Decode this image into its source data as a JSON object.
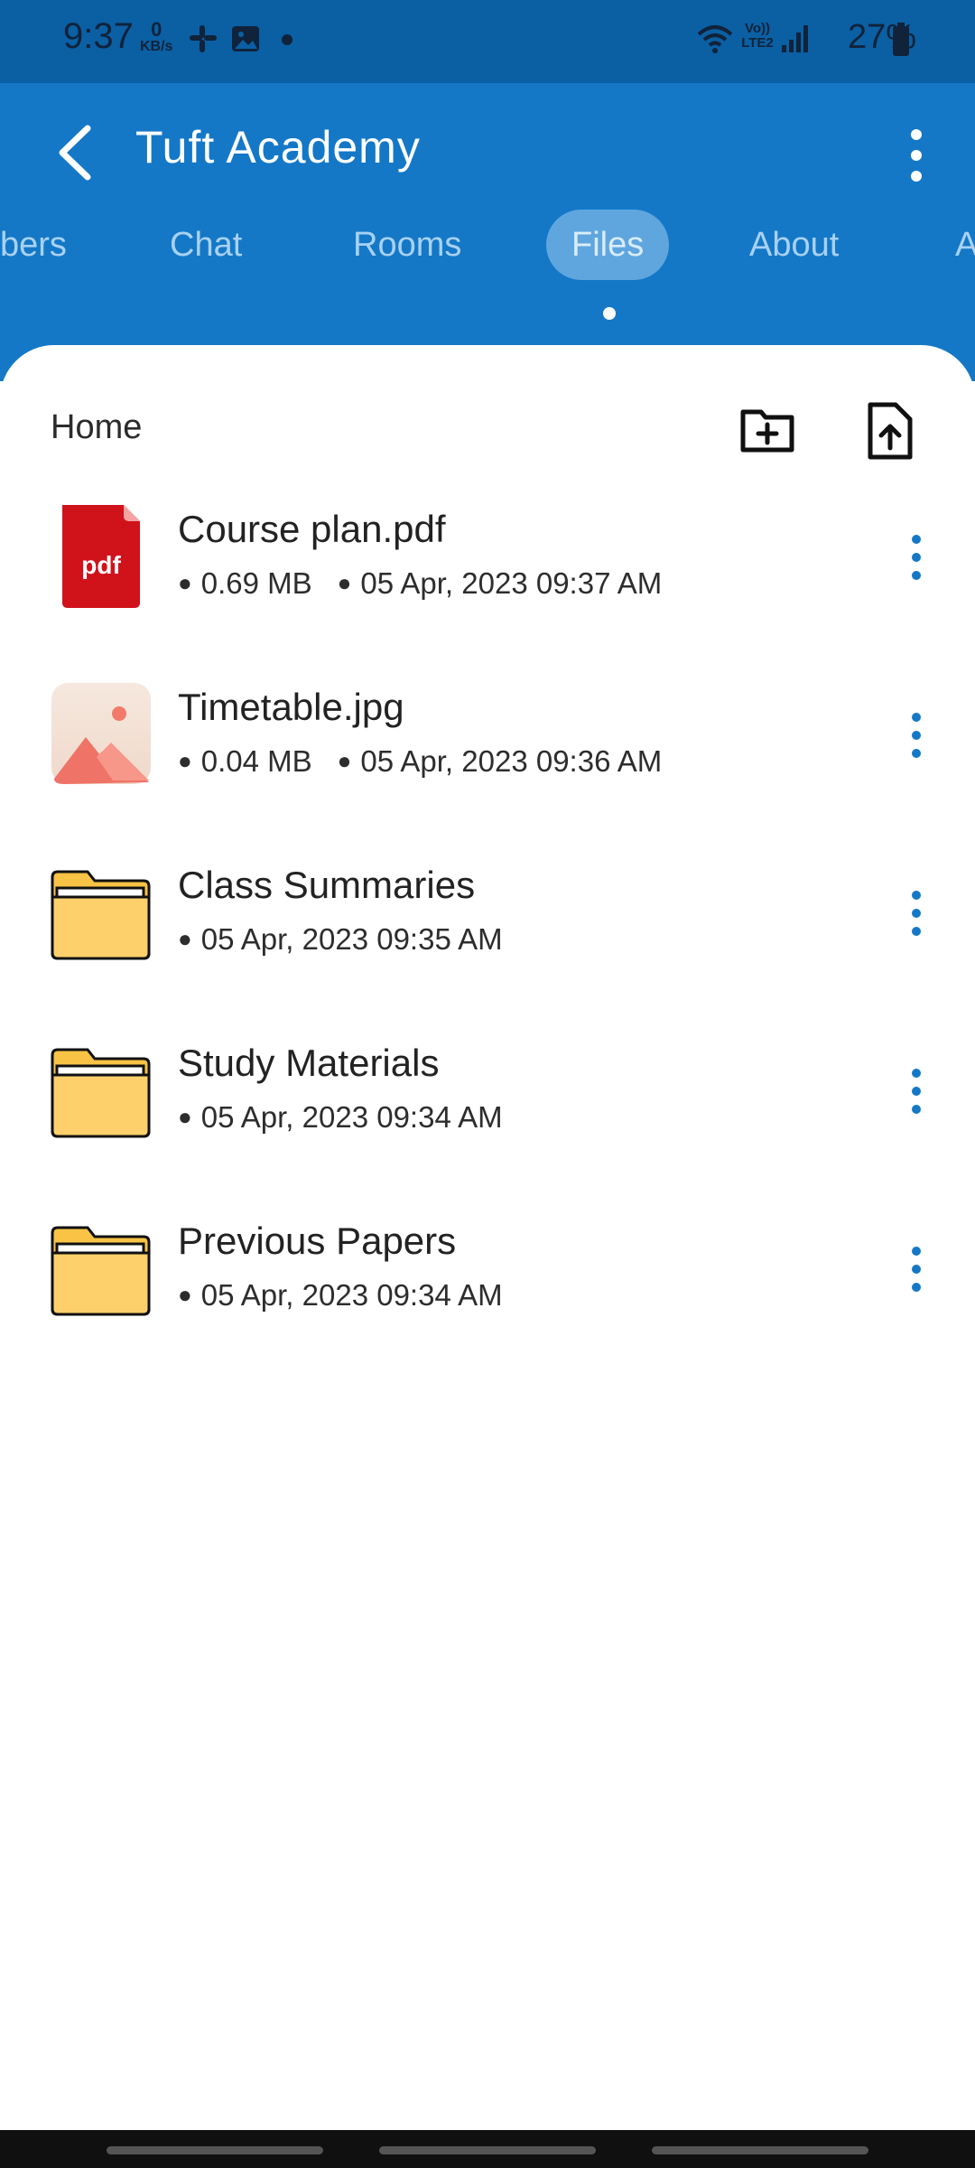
{
  "status_bar": {
    "time": "9:37",
    "speed_value": "0",
    "speed_unit": "KB/s",
    "network_label": "Vo)) LTE2",
    "battery": "27%",
    "icons": [
      "slack-icon",
      "gallery-icon",
      "wifi-icon",
      "signal-icon",
      "battery-icon"
    ]
  },
  "header": {
    "title": "Tuft Academy",
    "tabs": [
      "bers",
      "Chat",
      "Rooms",
      "Files",
      "About",
      "A"
    ],
    "active_tab": "Files"
  },
  "breadcrumb": "Home",
  "actions": {
    "new_folder_icon": "folder-plus-icon",
    "upload_icon": "file-upload-icon"
  },
  "files": [
    {
      "name": "Course plan.pdf",
      "size": "0.69 MB",
      "date": "05 Apr, 2023 09:37 AM",
      "type": "pdf",
      "icon_text": "pdf"
    },
    {
      "name": "Timetable.jpg",
      "size": "0.04 MB",
      "date": "05 Apr, 2023 09:36 AM",
      "type": "image"
    },
    {
      "name": "Class Summaries",
      "date": "05 Apr, 2023 09:35 AM",
      "type": "folder"
    },
    {
      "name": "Study Materials",
      "date": "05 Apr, 2023 09:34 AM",
      "type": "folder"
    },
    {
      "name": "Previous Papers",
      "date": "05 Apr, 2023 09:34 AM",
      "type": "folder"
    }
  ],
  "colors": {
    "status_bar": "#0b5fa3",
    "header": "#1478c7",
    "accent": "#1478c7",
    "pdf_red": "#d0121b",
    "folder_yellow": "#fdd06b"
  }
}
